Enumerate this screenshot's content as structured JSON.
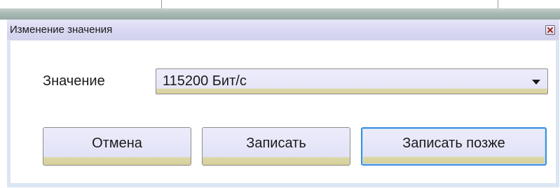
{
  "dialog": {
    "title": "Изменение значения",
    "close_icon": "close-icon"
  },
  "form": {
    "value_label": "Значение",
    "value_selected": "115200 Бит/с"
  },
  "buttons": {
    "cancel_label": "Отмена",
    "write_label": "Записать",
    "write_later_label": "Записать позже"
  },
  "colors": {
    "titlebar": "#d9d8f2",
    "frame": "#dbe6f4",
    "button_face": "#e2e2f8",
    "button_bottom_band": "#d6d09a",
    "focus_border": "#3c8fe0"
  }
}
